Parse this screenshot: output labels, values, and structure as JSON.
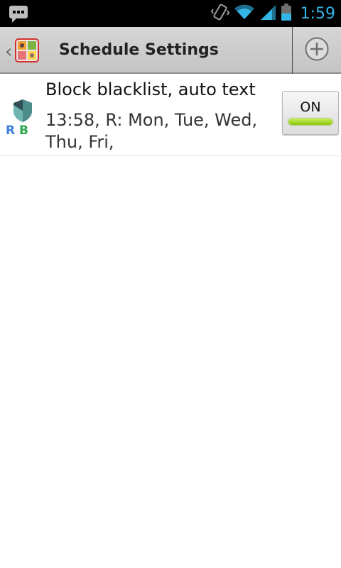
{
  "status_bar": {
    "time": "1:59",
    "icons": [
      "bbm-chat-icon",
      "vibrate-icon",
      "wifi-icon",
      "signal-icon",
      "battery-icon"
    ]
  },
  "action_bar": {
    "title": "Schedule Settings",
    "back_icon": "chevron-left-icon",
    "app_icon": "app-logo-icon",
    "add_icon": "add-circle-icon"
  },
  "schedules": [
    {
      "title": "Block blacklist, auto text",
      "subtitle": "13:58, R: Mon, Tue, Wed, Thu, Fri,",
      "icon": "shield-rb-icon",
      "icon_letters": [
        "R",
        "B"
      ],
      "toggle_label": "ON",
      "enabled": true
    }
  ],
  "colors": {
    "status_time": "#33b5e5",
    "toggle_on": "#8bc50c"
  }
}
